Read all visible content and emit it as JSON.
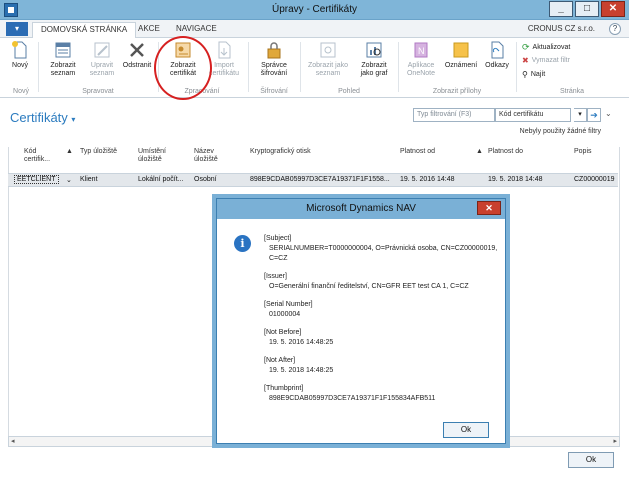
{
  "window": {
    "title": "Úpravy - Certifikáty"
  },
  "tabs": [
    {
      "label": "DOMOVSKÁ STRÁNKA"
    },
    {
      "label": "AKCE"
    },
    {
      "label": "NAVIGACE"
    }
  ],
  "company": "CRONUS CZ s.r.o.",
  "ribbon": {
    "groups": {
      "novy": "Nový",
      "spravovat": "Spravovat",
      "zpracovani": "Zpracování",
      "sifrovani": "Šifrování",
      "pohled": "Pohled",
      "prilohy": "Zobrazit přílohy",
      "stranka": "Stránka"
    },
    "buttons": {
      "novy": "Nový",
      "zobrazit_seznam": "Zobrazit seznam",
      "upravit_seznam": "Upravit seznam",
      "odstranit": "Odstranit",
      "zobrazit_certifikat": "Zobrazit certifikát",
      "import_certifikatu": "Import certifikátu",
      "spravce_sifrovani": "Správce šifrování",
      "zobrazit_jako_seznam": "Zobrazit jako seznam",
      "zobrazit_jako_graf": "Zobrazit jako graf",
      "aplikace_onenote": "Aplikace OneNote",
      "oznameni": "Oznámení",
      "odkazy": "Odkazy",
      "aktualizovat": "Aktualizovat",
      "vymazat_filtr": "Vymazat filtr",
      "najit": "Najít"
    }
  },
  "page": {
    "title": "Certifikáty",
    "filter_placeholder": "Typ filtrování (F3)",
    "filter_field": "Kód certifikátu",
    "no_filters": "Nebyly použity žádné filtry"
  },
  "grid": {
    "headers": {
      "kod": "Kód certifik...",
      "typ": "Typ úložiště",
      "umisteni": "Umístění úložiště",
      "nazev": "Název úložiště",
      "otisk": "Kryptografický otisk",
      "platnost_od": "Platnost od",
      "platnost_do": "Platnost do",
      "popis": "Popis"
    },
    "row": {
      "kod": "EETCLIENT",
      "typ": "Klient",
      "umisteni": "Lokální počít...",
      "nazev": "Osobní",
      "otisk": "898E9CDAB05997D3CE7A19371F1F1558...",
      "platnost_od": "19. 5. 2016 14:48",
      "platnost_do": "19. 5. 2018 14:48",
      "popis": "CZ00000019"
    }
  },
  "ok_label": "Ok",
  "dialog": {
    "title": "Microsoft Dynamics NAV",
    "subject_label": "[Subject]",
    "subject_value": "SERIALNUMBER=T0000000004, O=Právnická osoba, CN=CZ00000019, C=CZ",
    "issuer_label": "[Issuer]",
    "issuer_value": "O=Generální finanční ředitelství, CN=GFR EET test CA 1, C=CZ",
    "serial_label": "[Serial Number]",
    "serial_value": "01000004",
    "notbefore_label": "[Not Before]",
    "notbefore_value": "19. 5. 2016 14:48:25",
    "notafter_label": "[Not After]",
    "notafter_value": "19. 5. 2018 14:48:25",
    "thumb_label": "[Thumbprint]",
    "thumb_value": "898E9CDAB05997D3CE7A19371F1F155834AFB511",
    "ok_label": "Ok"
  },
  "colors": {
    "accent": "#2b7bbf",
    "titlebar": "#7fb5d8",
    "highlight": "#d62020"
  }
}
